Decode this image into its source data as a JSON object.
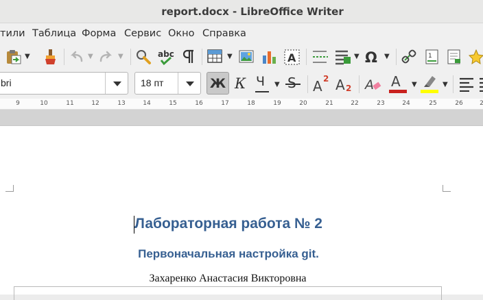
{
  "window": {
    "title": "report.docx - LibreOffice Writer"
  },
  "menu": [
    "тили",
    "Таблица",
    "Форма",
    "Сервис",
    "Окно",
    "Справка"
  ],
  "formatting": {
    "font_name": "bri",
    "font_size": "18 пт",
    "bold_label": "Ж",
    "italic_label": "К",
    "underline_label": "Ч",
    "strike_label": "S",
    "superscript_label": "A",
    "superscript_mark": "2",
    "subscript_label": "A",
    "subscript_mark": "2",
    "font_color_label": "A",
    "colors": {
      "font_color": "#c9211e",
      "highlight": "#ffff00",
      "accent": "#365f91"
    }
  },
  "ruler": [
    "9",
    "10",
    "11",
    "12",
    "13",
    "14",
    "15",
    "16",
    "17",
    "18",
    "19",
    "20",
    "21",
    "22",
    "23",
    "24",
    "25",
    "26",
    "2"
  ],
  "document": {
    "heading": "Лабораторная работа № 2",
    "subheading": "Первоначальная настройка git.",
    "author": "Захаренко Анастасия Викторовна"
  }
}
